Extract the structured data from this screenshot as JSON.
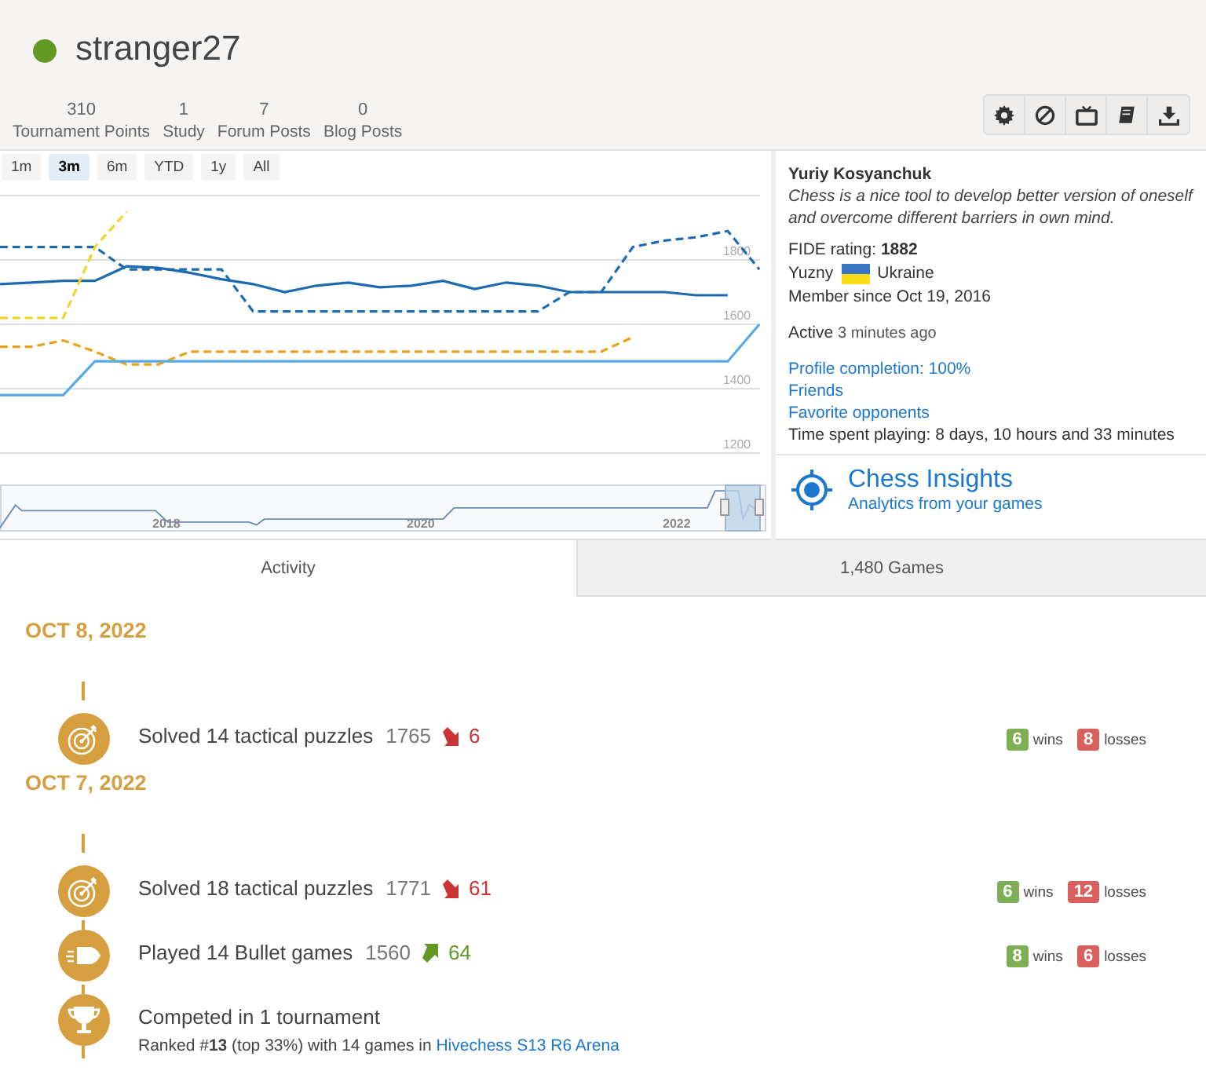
{
  "profile": {
    "username": "stranger27",
    "online": true
  },
  "stats": [
    {
      "value": "310",
      "label": "Tournament Points"
    },
    {
      "value": "1",
      "label": "Study"
    },
    {
      "value": "7",
      "label": "Forum Posts"
    },
    {
      "value": "0",
      "label": "Blog Posts"
    }
  ],
  "actions": [
    {
      "kind": "gear"
    },
    {
      "kind": "block"
    },
    {
      "kind": "tv"
    },
    {
      "kind": "book"
    },
    {
      "kind": "download"
    }
  ],
  "chart": {
    "ranges": [
      {
        "label": "1m",
        "selected": false
      },
      {
        "label": "3m",
        "selected": true
      },
      {
        "label": "6m",
        "selected": false
      },
      {
        "label": "YTD",
        "selected": false
      },
      {
        "label": "1y",
        "selected": false
      },
      {
        "label": "All",
        "selected": false
      }
    ],
    "chart_data": {
      "type": "line",
      "grid": true,
      "ylim": [
        1200,
        2000
      ],
      "yticks": [
        1200,
        1400,
        1600,
        1800
      ],
      "series": [
        {
          "color": "#1c6bb0",
          "line_style": "solid",
          "values": [
            1725,
            1730,
            1735,
            1735,
            1780,
            1775,
            1760,
            1740,
            1725,
            1700,
            1720,
            1730,
            1715,
            1720,
            1735,
            1710,
            1730,
            1720,
            1700,
            1700,
            1700,
            1700,
            1690,
            1690,
            null
          ]
        },
        {
          "color": "#1c6bb0",
          "line_style": "dashed",
          "values": [
            1840,
            1840,
            1840,
            1840,
            1770,
            1770,
            1770,
            1770,
            1640,
            1640,
            1640,
            1640,
            1640,
            1640,
            1640,
            1640,
            1640,
            1640,
            1700,
            1700,
            1840,
            1860,
            1870,
            1890,
            1770
          ]
        },
        {
          "color": "#f5d327",
          "line_style": "dashed",
          "values": [
            1620,
            1620,
            1620,
            1840,
            1950,
            null,
            null,
            null,
            null,
            null,
            null,
            null,
            null,
            null,
            null,
            null,
            null,
            null,
            null,
            null,
            null,
            null,
            null,
            null,
            null
          ]
        },
        {
          "color": "#e8a21b",
          "line_style": "dashed",
          "values": [
            1530,
            1530,
            1550,
            1515,
            1475,
            1475,
            1515,
            1515,
            1515,
            1515,
            1515,
            1515,
            1515,
            1515,
            1515,
            1515,
            1515,
            1515,
            1515,
            1515,
            1560,
            null,
            null,
            null,
            null
          ]
        },
        {
          "color": "#56a8e6",
          "line_style": "solid",
          "values": [
            1380,
            1380,
            1380,
            1485,
            1485,
            1485,
            1485,
            1485,
            1485,
            1485,
            1485,
            1485,
            1485,
            1485,
            1485,
            1485,
            1485,
            1485,
            1485,
            1485,
            1485,
            1485,
            1485,
            1485,
            1600
          ]
        }
      ]
    },
    "navigator": {
      "labels": [
        "2018",
        "2020",
        "2022"
      ]
    }
  },
  "bio": {
    "name": "Yuriy Kosyanchuk",
    "quote": "Chess is a nice tool to develop better version of oneself and overcome different barriers in own mind.",
    "fide_label": "FIDE rating:",
    "fide": "1882",
    "city": "Yuzny",
    "country": "Ukraine",
    "member_since": "Member since Oct 19, 2016",
    "active_label": "Active",
    "active_time": "3 minutes ago",
    "links": [
      "Profile completion: 100%",
      "Friends",
      "Favorite opponents"
    ],
    "time_played": "Time spent playing: 8 days, 10 hours and 33 minutes"
  },
  "insights": {
    "title": "Chess Insights",
    "subtitle": "Analytics from your games"
  },
  "tabs": [
    {
      "label": "Activity",
      "selected": true
    },
    {
      "label": "1,480 Games",
      "selected": false
    }
  ],
  "activity": [
    {
      "date": "OCT 8, 2022",
      "entries": [
        {
          "kind": "puzzle",
          "text": "Solved 14 tactical puzzles",
          "rating": "1765",
          "rising": false,
          "change": "6",
          "wins": "6",
          "wins_label": "wins",
          "losses": "8",
          "losses_label": "losses"
        }
      ]
    },
    {
      "date": "OCT 7, 2022",
      "entries": [
        {
          "kind": "puzzle",
          "text": "Solved 18 tactical puzzles",
          "rating": "1771",
          "rising": false,
          "change": "61",
          "wins": "6",
          "wins_label": "wins",
          "losses": "12",
          "losses_label": "losses"
        },
        {
          "kind": "bullet",
          "text": "Played 14 Bullet games",
          "rating": "1560",
          "rising": true,
          "change": "64",
          "wins": "8",
          "wins_label": "wins",
          "losses": "6",
          "losses_label": "losses"
        },
        {
          "kind": "tournament",
          "text": "Competed in 1 tournament",
          "detail": "Ranked #**13** (top 33%) with 14 games in",
          "link": "Hivechess S13 R6 Arena"
        }
      ]
    }
  ]
}
